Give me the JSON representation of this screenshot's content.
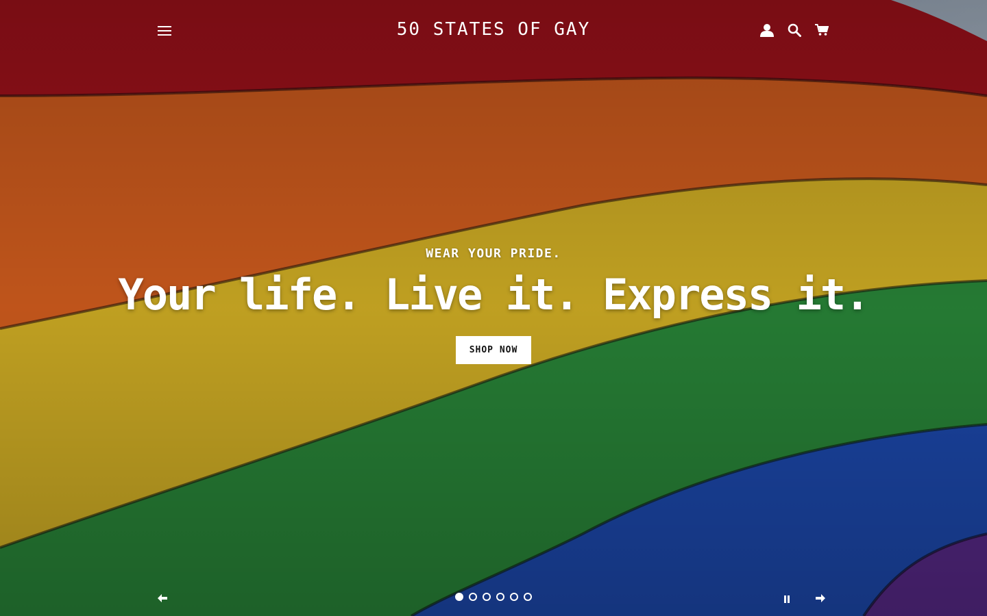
{
  "header": {
    "logo": "50 STATES OF GAY",
    "icons": [
      "menu-icon",
      "account-icon",
      "search-icon",
      "cart-icon"
    ]
  },
  "hero": {
    "eyebrow": "WEAR YOUR PRIDE.",
    "headline": "Your life. Live it. Express it.",
    "button_label": "SHOP NOW",
    "flag_colors": [
      "#b3141e",
      "#e0651e",
      "#e3c22a",
      "#2e8e3a",
      "#1f4fb8",
      "#5b2a8e"
    ]
  },
  "slideshow": {
    "slide_count": 6,
    "active_index": 0,
    "icons": [
      "arrow-left-icon",
      "pause-icon",
      "arrow-right-icon"
    ]
  }
}
